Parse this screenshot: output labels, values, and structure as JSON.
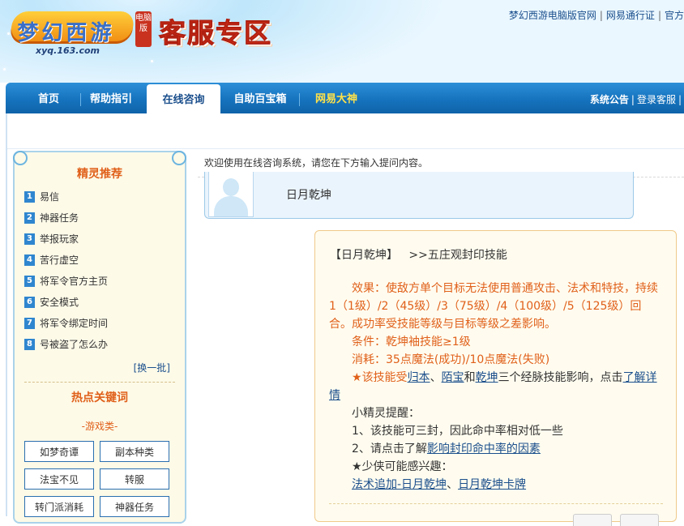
{
  "header": {
    "logo_text": "梦幻西游",
    "logo_tag": "电脑版",
    "logo_url": "xyq.163.com",
    "zone_title": "客服专区",
    "top_links": [
      "梦幻西游电脑版官网",
      "网易通行证",
      "官方"
    ]
  },
  "nav": {
    "items": [
      "首页",
      "帮助指引",
      "在线咨询",
      "自助百宝箱",
      "网易大神"
    ],
    "active_index": 2,
    "right_links": [
      "系统公告",
      "登录客服"
    ]
  },
  "sidebar": {
    "recommend_title": "精灵推荐",
    "recommend_items": [
      {
        "num": "1",
        "label": "易信"
      },
      {
        "num": "2",
        "label": "神器任务"
      },
      {
        "num": "3",
        "label": "举报玩家"
      },
      {
        "num": "4",
        "label": "苦行虚空"
      },
      {
        "num": "5",
        "label": "将军令官方主页"
      },
      {
        "num": "6",
        "label": "安全模式"
      },
      {
        "num": "7",
        "label": "将军令绑定时间"
      },
      {
        "num": "8",
        "label": "号被盗了怎么办"
      }
    ],
    "change_label": "[换一批]",
    "hot_title": "热点关键词",
    "category_label": "-游戏类-",
    "keywords": [
      "如梦奇谭",
      "副本种类",
      "法宝不见",
      "转服",
      "转门派消耗",
      "神器任务"
    ]
  },
  "main": {
    "welcome": "欢迎使用在线咨询系统，请您在下方输入提问内容。",
    "user_question": "日月乾坤",
    "answer": {
      "head_left": "【日月乾坤】",
      "head_right": ">>五庄观封印技能",
      "effect": "效果：使敌方单个目标无法使用普通攻击、法术和特技，持续1（1级）/2（45级）/3（75级）/4（100级）/5（125级）回合。成功率受技能等级与目标等级之差影响。",
      "condition": "条件：乾坤袖技能≥1级",
      "cost": "消耗：35点魔法(成功)/10点魔法(失败)",
      "star1": "★",
      "affect_pre": "该技能受",
      "affect_a": "归本",
      "affect_sep1": "、",
      "affect_b": "陌宝",
      "affect_sep2": "和",
      "affect_c": "乾坤",
      "affect_mid": "三个经脉技能影响，点击",
      "affect_link": "了解详情",
      "tips_title": "小精灵提醒：",
      "tip1": "1、该技能可三封，因此命中率相对低一些",
      "tip2_pre": "2、请点击了解",
      "tip2_link": "影响封印命中率的因素",
      "interest": "★少侠可能感兴趣：",
      "interest_link1": "法术追加-日月乾坤",
      "interest_sep": "、",
      "interest_link2": "日月乾坤卡牌"
    }
  }
}
